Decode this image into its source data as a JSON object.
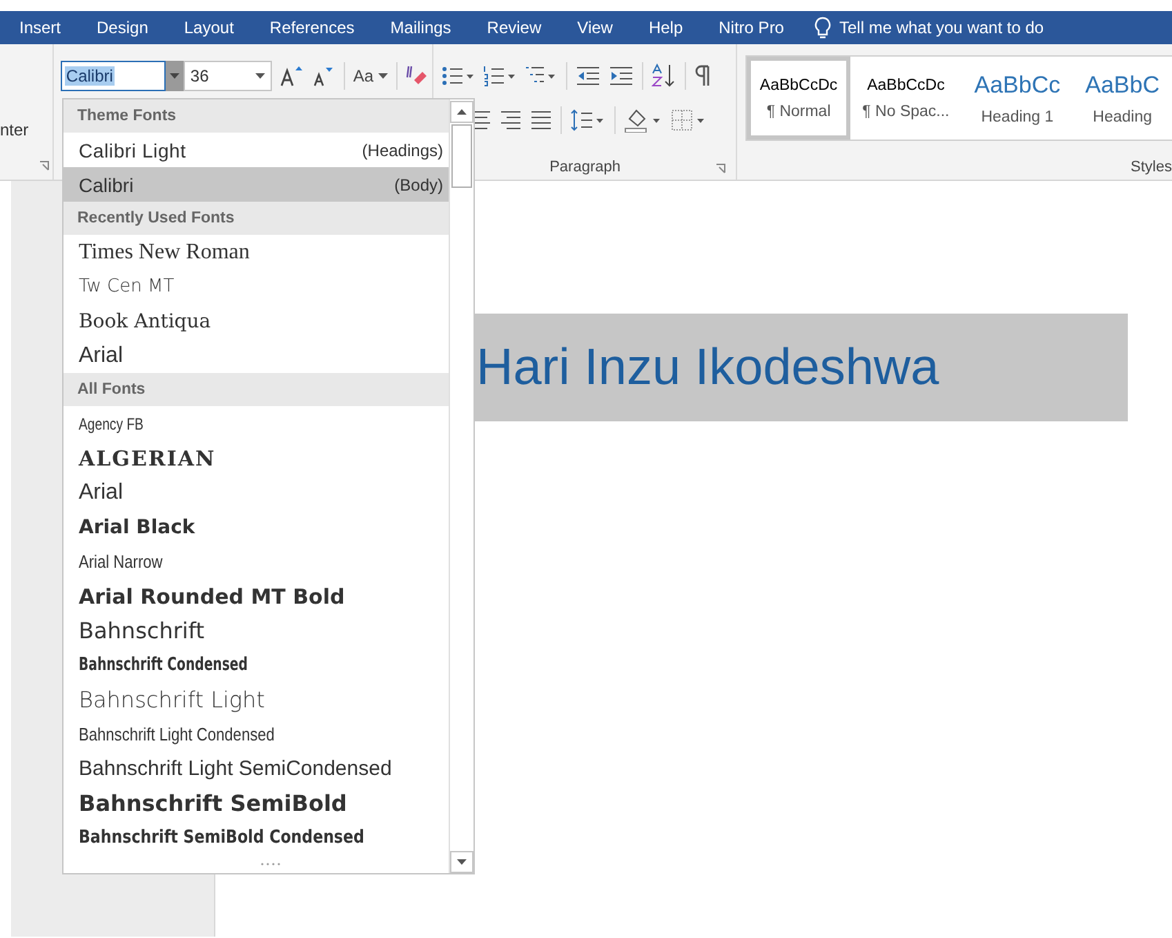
{
  "ribbon_tabs": [
    {
      "label": "Insert"
    },
    {
      "label": "Design"
    },
    {
      "label": "Layout"
    },
    {
      "label": "References"
    },
    {
      "label": "Mailings"
    },
    {
      "label": "Review"
    },
    {
      "label": "View"
    },
    {
      "label": "Help"
    },
    {
      "label": "Nitro Pro"
    }
  ],
  "tell_me": "Tell me what you want to do",
  "clipboard_group": {
    "label_fragment": "nter"
  },
  "font_group": {
    "font_name": "Calibri",
    "font_size": "36",
    "change_case": "Aa"
  },
  "paragraph_group": {
    "label": "Paragraph"
  },
  "styles": {
    "label": "Styles",
    "items": [
      {
        "preview": "AaBbCcDc",
        "name": "¶ Normal",
        "kind": "body",
        "selected": true
      },
      {
        "preview": "AaBbCcDc",
        "name": "¶ No Spac...",
        "kind": "body",
        "selected": false
      },
      {
        "preview": "AaBbCc",
        "name": "Heading 1",
        "kind": "heading",
        "selected": false
      },
      {
        "preview": "AaBbC",
        "name": "Heading",
        "kind": "heading",
        "selected": false
      }
    ]
  },
  "font_dropdown": {
    "sections": [
      {
        "heading": "Theme Fonts",
        "fonts": [
          {
            "name": "Calibri Light",
            "note": "(Headings)",
            "selected": false
          },
          {
            "name": "Calibri",
            "note": "(Body)",
            "selected": true
          }
        ]
      },
      {
        "heading": "Recently Used Fonts",
        "fonts": [
          {
            "name": "Times New Roman",
            "selected": false
          },
          {
            "name": "Tw Cen MT",
            "selected": false
          },
          {
            "name": "Book Antiqua",
            "selected": false
          },
          {
            "name": "Arial",
            "selected": false
          }
        ]
      },
      {
        "heading": "All Fonts",
        "fonts": [
          {
            "name": "Agency FB",
            "selected": false
          },
          {
            "name": "ALGERIAN",
            "selected": false
          },
          {
            "name": "Arial",
            "selected": false
          },
          {
            "name": "Arial Black",
            "selected": false
          },
          {
            "name": "Arial Narrow",
            "selected": false
          },
          {
            "name": "Arial Rounded MT Bold",
            "selected": false
          },
          {
            "name": "Bahnschrift",
            "selected": false
          },
          {
            "name": "Bahnschrift Condensed",
            "selected": false
          },
          {
            "name": "Bahnschrift Light",
            "selected": false
          },
          {
            "name": "Bahnschrift Light Condensed",
            "selected": false
          },
          {
            "name": "Bahnschrift Light SemiCondensed",
            "selected": false
          },
          {
            "name": "Bahnschrift SemiBold",
            "selected": false
          },
          {
            "name": "Bahnschrift SemiBold Condensed",
            "selected": false
          }
        ]
      }
    ]
  },
  "document": {
    "text": "Hari Inzu Ikodeshwa"
  }
}
